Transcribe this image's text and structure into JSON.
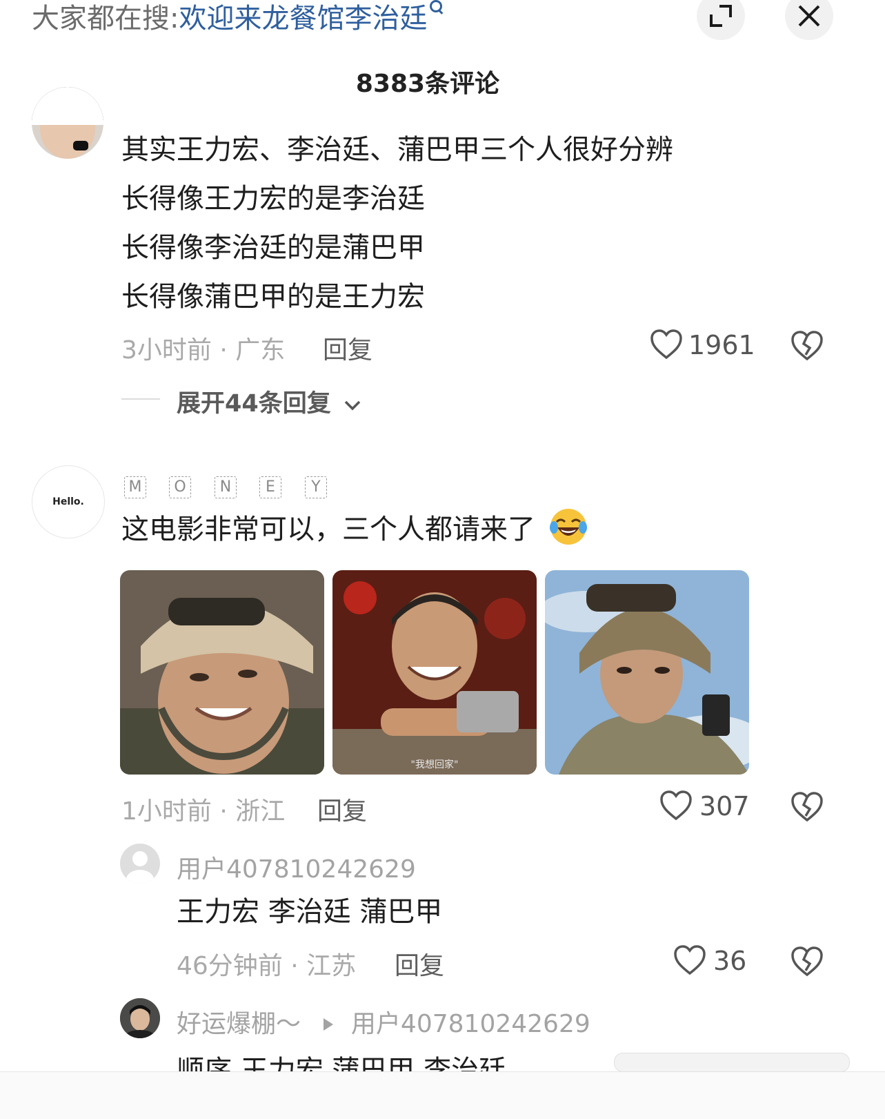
{
  "header": {
    "search_prefix": "大家都在搜:",
    "search_term": "欢迎来龙餐馆李治廷",
    "comment_count": "8383条评论"
  },
  "comments": [
    {
      "lines": [
        "其实王力宏、李治廷、蒲巴甲三个人很好分辨",
        "长得像王力宏的是李治廷",
        "长得像李治廷的是蒲巴甲",
        "长得像蒲巴甲的是王力宏"
      ],
      "meta": "3小时前 · 广东",
      "reply_label": "回复",
      "likes": "1961",
      "expand_label": "展开44条回复"
    },
    {
      "avatar_text": "Hello.",
      "name_badge": [
        "M",
        "O",
        "N",
        "E",
        "Y"
      ],
      "text": "这电影非常可以，三个人都请来了",
      "image_caption": "\"我想回家\"",
      "meta": "1小时前 · 浙江",
      "reply_label": "回复",
      "likes": "307"
    }
  ],
  "replies": [
    {
      "username": "用户407810242629",
      "text": "王力宏 李治廷 蒲巴甲",
      "meta": "46分钟前 · 江苏",
      "reply_label": "回复",
      "likes": "36"
    },
    {
      "username": "好运爆棚～",
      "reply_to": "用户407810242629",
      "text": "顺序 王力宏 蒲巴甲 李治廷"
    }
  ],
  "colors": {
    "link": "#2f5f9e",
    "meta": "#a9a9a9",
    "text": "#1e1e1e"
  }
}
